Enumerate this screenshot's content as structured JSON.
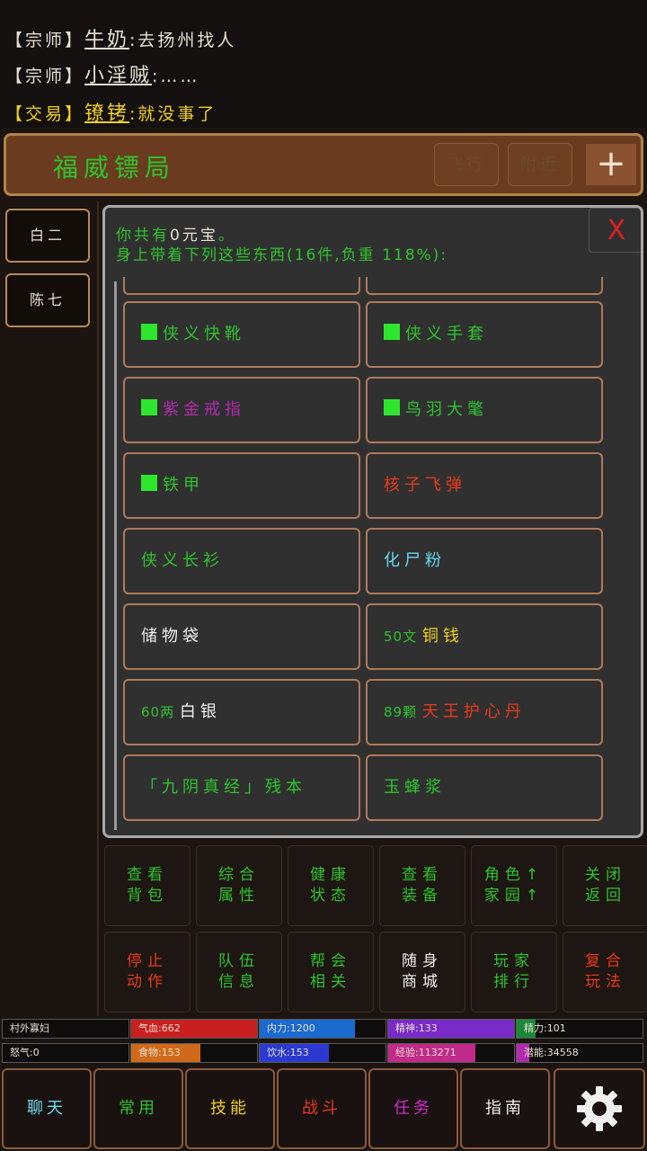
{
  "chat": {
    "lines": [
      {
        "tag": "【宗师】",
        "name": "牛奶",
        "msg": ":去扬州找人"
      },
      {
        "tag": "【宗师】",
        "name": "小淫贼",
        "msg": ":……"
      },
      {
        "tag": "【交易】",
        "name": "镣铐",
        "msg": ":就没事了"
      }
    ]
  },
  "location": {
    "title": "福威镖局",
    "fly_label": "飞行",
    "nearby_label": "附近",
    "plus_label": "+"
  },
  "npcs": [
    "白二",
    "陈七"
  ],
  "dialog": {
    "money_prefix": "你共有",
    "money_value": "0元宝",
    "money_suffix": "。",
    "desc": "身上带着下列这些东西(16件,负重 118%):",
    "close_label": "X",
    "items": [
      {
        "label": "侠义快靴",
        "color": "#2ec42e",
        "marker": true
      },
      {
        "label": "侠义手套",
        "color": "#2ec42e",
        "marker": true
      },
      {
        "label": "紫金戒指",
        "color": "#b02ab0",
        "marker": true
      },
      {
        "label": "鸟羽大氅",
        "color": "#2ec42e",
        "marker": true
      },
      {
        "label": "铁甲",
        "color": "#2ec42e",
        "marker": true
      },
      {
        "label": "核子飞弹",
        "color": "#e83a1a",
        "marker": false
      },
      {
        "label": "侠义长衫",
        "color": "#2ec42e",
        "marker": false
      },
      {
        "label": "化尸粉",
        "color": "#6ad8f0",
        "marker": false
      },
      {
        "label": "储物袋",
        "color": "#f0f0f0",
        "marker": false
      },
      {
        "label": "50文 铜钱",
        "prefix": "50文 ",
        "name": "铜钱",
        "color": "#f0d020",
        "prefix_color": "#2ec42e",
        "marker": false
      },
      {
        "label": "60两 白银",
        "prefix": "60两 ",
        "name": "白银",
        "color": "#f0f0f0",
        "prefix_color": "#2ec42e",
        "marker": false
      },
      {
        "label": "89颗 天王护心丹",
        "prefix": "89颗 ",
        "name": "天王护心丹",
        "color": "#e83a1a",
        "prefix_color": "#2ec42e",
        "marker": false
      },
      {
        "label": "「九阴真经」残本",
        "color": "#2ec42e",
        "marker": false
      },
      {
        "label": "玉蜂浆",
        "color": "#2ec42e",
        "marker": false
      }
    ]
  },
  "actions": [
    {
      "label": "查看\n背包",
      "color": "#2ec42e"
    },
    {
      "label": "综合\n属性",
      "color": "#2ec42e"
    },
    {
      "label": "健康\n状态",
      "color": "#2ec42e"
    },
    {
      "label": "查看\n装备",
      "color": "#2ec42e"
    },
    {
      "label": "角色↑\n家园↑",
      "color": "#2ec42e"
    },
    {
      "label": "关闭\n返回",
      "color": "#2ec42e"
    },
    {
      "label": "停止\n动作",
      "color": "#e83a1a"
    },
    {
      "label": "队伍\n信息",
      "color": "#2ec42e"
    },
    {
      "label": "帮会\n相关",
      "color": "#2ec42e"
    },
    {
      "label": "随身\n商城",
      "color": "#f0f0f0"
    },
    {
      "label": "玩家\n排行",
      "color": "#2ec42e"
    },
    {
      "label": "复合\n玩法",
      "color": "#e83a1a"
    }
  ],
  "status": [
    {
      "label": "村外寡妇",
      "fill": 0,
      "fill_color": "#000000"
    },
    {
      "label": "气血:662",
      "fill": 1.0,
      "fill_color": "#c82020"
    },
    {
      "label": "内力:1200",
      "fill": 0.76,
      "fill_color": "#1a6ad0"
    },
    {
      "label": "精神:133",
      "fill": 1.0,
      "fill_color": "#7a2ac8"
    },
    {
      "label": "精力:101",
      "fill": 0.15,
      "fill_color": "#1a8a3a"
    },
    {
      "label": "怒气:0",
      "fill": 0,
      "fill_color": "#000000"
    },
    {
      "label": "食物:153",
      "fill": 0.55,
      "fill_color": "#d06a1a"
    },
    {
      "label": "饮水:153",
      "fill": 0.55,
      "fill_color": "#2a3ad0"
    },
    {
      "label": "经验:113271",
      "fill": 0.69,
      "fill_color": "#c02a8a"
    },
    {
      "label": "潜能:34558",
      "fill": 0.1,
      "fill_color": "#b02ab0"
    }
  ],
  "nav": [
    {
      "label": "聊天",
      "color": "#6ad8f0"
    },
    {
      "label": "常用",
      "color": "#2ec42e"
    },
    {
      "label": "技能",
      "color": "#f0d020"
    },
    {
      "label": "战斗",
      "color": "#e83a1a"
    },
    {
      "label": "任务",
      "color": "#d02ad0"
    },
    {
      "label": "指南",
      "color": "#f0f0f0"
    }
  ],
  "icons": {
    "settings": "gear-icon"
  }
}
